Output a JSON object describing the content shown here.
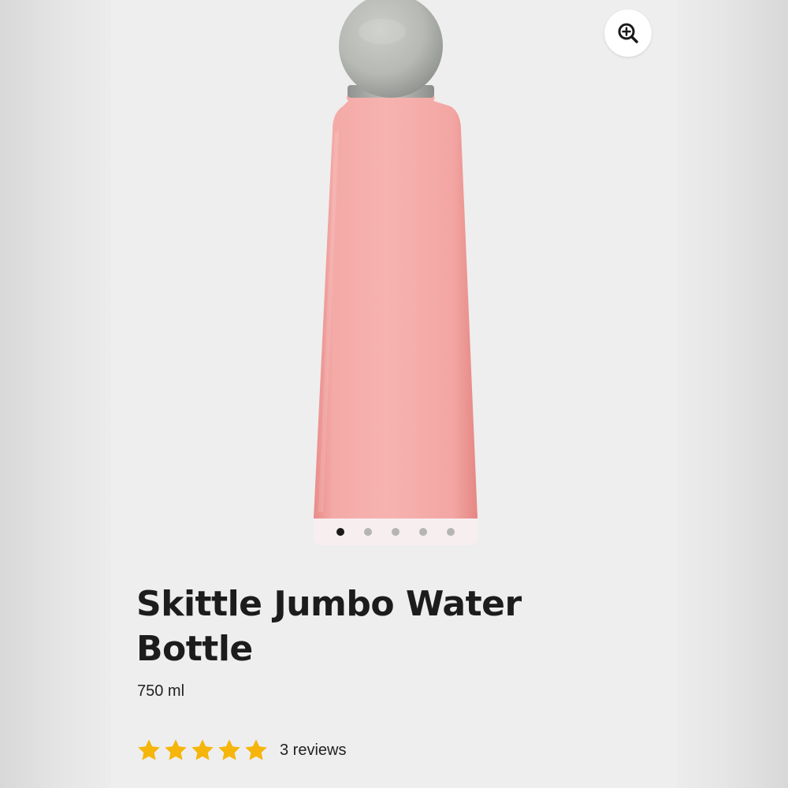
{
  "product": {
    "title": "Skittle Jumbo Water Bottle",
    "size": "750 ml",
    "bottle_color": "#f2a7a4",
    "cap_color": "#b5b8b4"
  },
  "gallery": {
    "image_count": 5,
    "active_index": 0
  },
  "rating": {
    "value": 5,
    "max": 5,
    "star_color": "#f5b50a",
    "reviews_label": "3 reviews"
  },
  "icons": {
    "zoom": "zoom-in-icon",
    "star": "star-icon"
  }
}
